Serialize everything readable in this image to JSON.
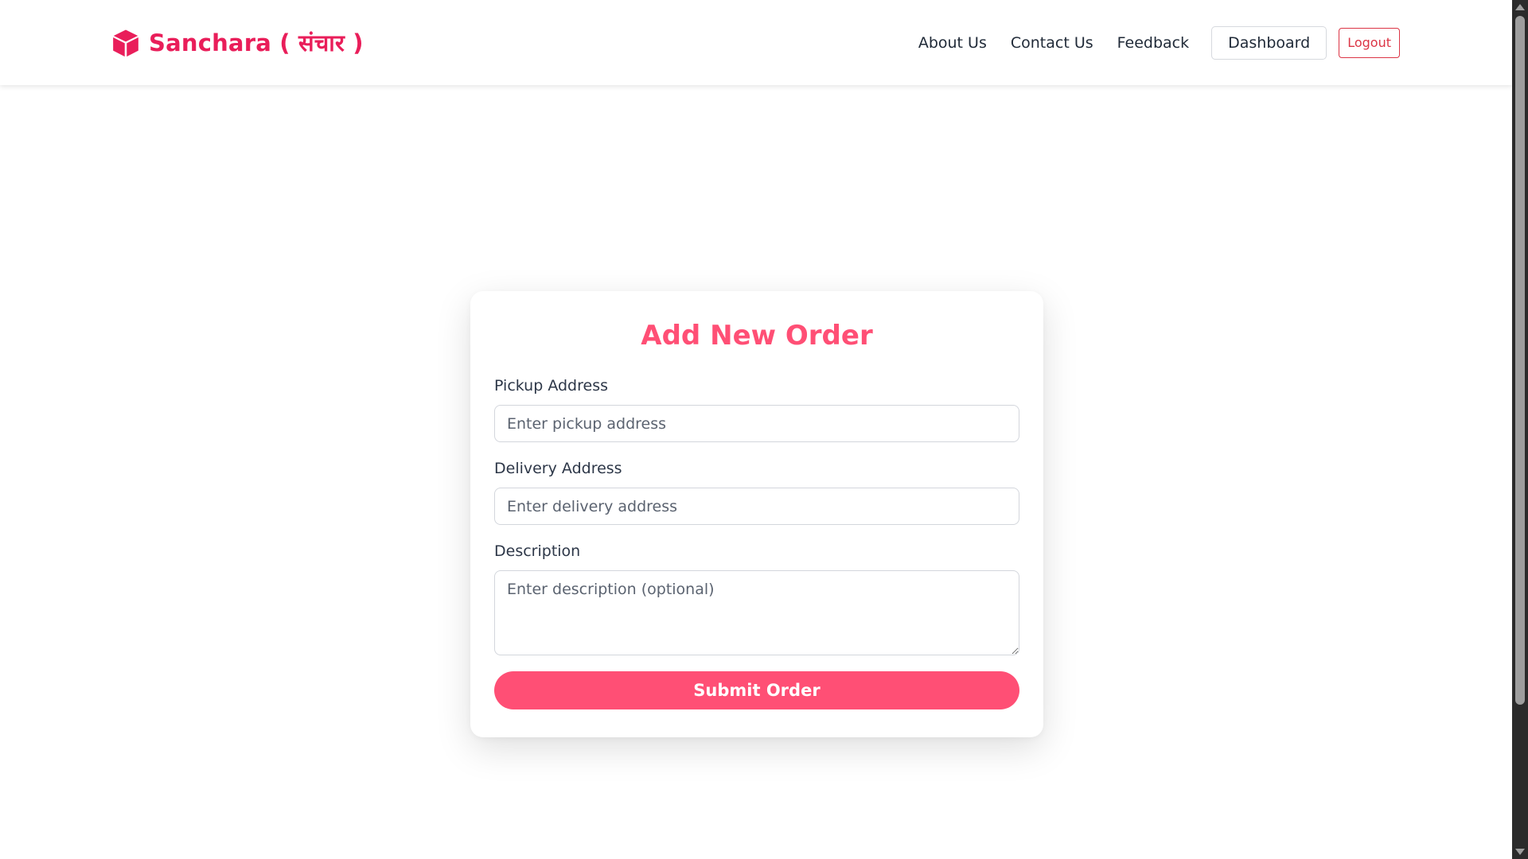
{
  "header": {
    "brand_name": "Sanchara ( संचार )",
    "brand_icon": "box-icon",
    "nav_links": [
      "About Us",
      "Contact Us",
      "Feedback"
    ],
    "dashboard_label": "Dashboard",
    "logout_label": "Logout"
  },
  "form": {
    "title": "Add New Order",
    "pickup": {
      "label": "Pickup Address",
      "placeholder": "Enter pickup address",
      "value": ""
    },
    "delivery": {
      "label": "Delivery Address",
      "placeholder": "Enter delivery address",
      "value": ""
    },
    "description": {
      "label": "Description",
      "placeholder": "Enter description (optional)",
      "value": ""
    },
    "submit_label": "Submit Order"
  },
  "colors": {
    "brand": "#e91e5a",
    "accent": "#ff4f75",
    "logout": "#dc3545"
  }
}
